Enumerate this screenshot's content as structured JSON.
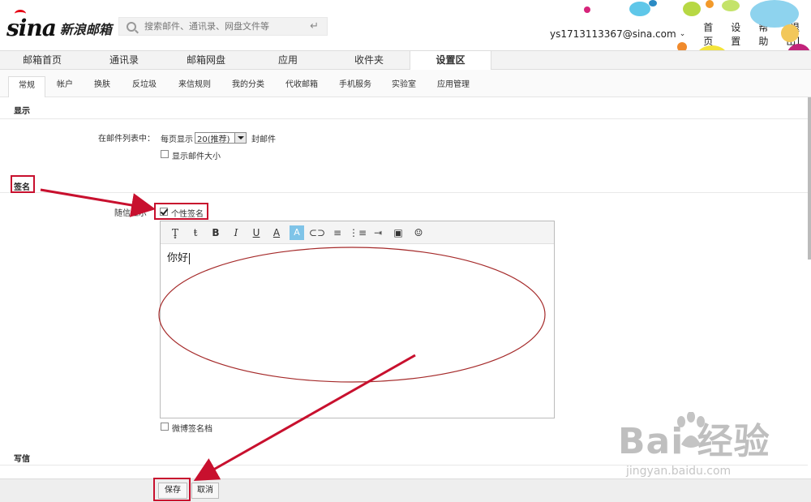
{
  "header": {
    "logo_text": "新浪邮箱",
    "logo_mark": "sina",
    "search_placeholder": "搜索邮件、通讯录、网盘文件等",
    "user_email": "ys1713113367@sina.com",
    "links": [
      "首页",
      "设置",
      "帮助",
      "[退出]"
    ]
  },
  "main_tabs": [
    {
      "label": "邮箱首页",
      "active": false
    },
    {
      "label": "通讯录",
      "active": false
    },
    {
      "label": "邮箱网盘",
      "active": false
    },
    {
      "label": "应用",
      "active": false
    },
    {
      "label": "收件夹",
      "active": false
    },
    {
      "label": "设置区",
      "active": true
    }
  ],
  "sub_tabs": [
    {
      "label": "常规",
      "active": true
    },
    {
      "label": "帐户",
      "active": false
    },
    {
      "label": "换肤",
      "active": false
    },
    {
      "label": "反垃圾",
      "active": false
    },
    {
      "label": "来信规则",
      "active": false
    },
    {
      "label": "我的分类",
      "active": false
    },
    {
      "label": "代收邮箱",
      "active": false
    },
    {
      "label": "手机服务",
      "active": false
    },
    {
      "label": "实验室",
      "active": false
    },
    {
      "label": "应用管理",
      "active": false
    }
  ],
  "display_section": {
    "title": "显示",
    "list_label": "在邮件列表中：",
    "per_page_label": "每页显示",
    "per_page_value": "20(推荐)",
    "unit": "封邮件",
    "show_size_label": "显示邮件大小",
    "show_size_checked": false
  },
  "signature_section": {
    "title": "签名",
    "with_mail_label": "随信显示",
    "personal_sig_label": "个性签名",
    "personal_sig_checked": true,
    "editor_text": "你好",
    "weibo_sig_label": "微博签名档",
    "weibo_sig_checked": false
  },
  "write_section": {
    "title": "写信"
  },
  "buttons": {
    "save": "保存",
    "cancel": "取消"
  },
  "toolbar_icons": [
    "font-size-icon",
    "font-size-small-icon",
    "bold-icon",
    "italic-icon",
    "underline-icon",
    "font-color-icon",
    "highlight-icon",
    "link-icon",
    "align-icon",
    "list-icon",
    "indent-icon",
    "image-icon",
    "emoji-icon"
  ],
  "watermark": {
    "main": "Bai  经验",
    "sub": "jingyan.baidu.com"
  },
  "colors": {
    "annotation_red": "#c8102e",
    "oval_red": "#a52a2a"
  }
}
